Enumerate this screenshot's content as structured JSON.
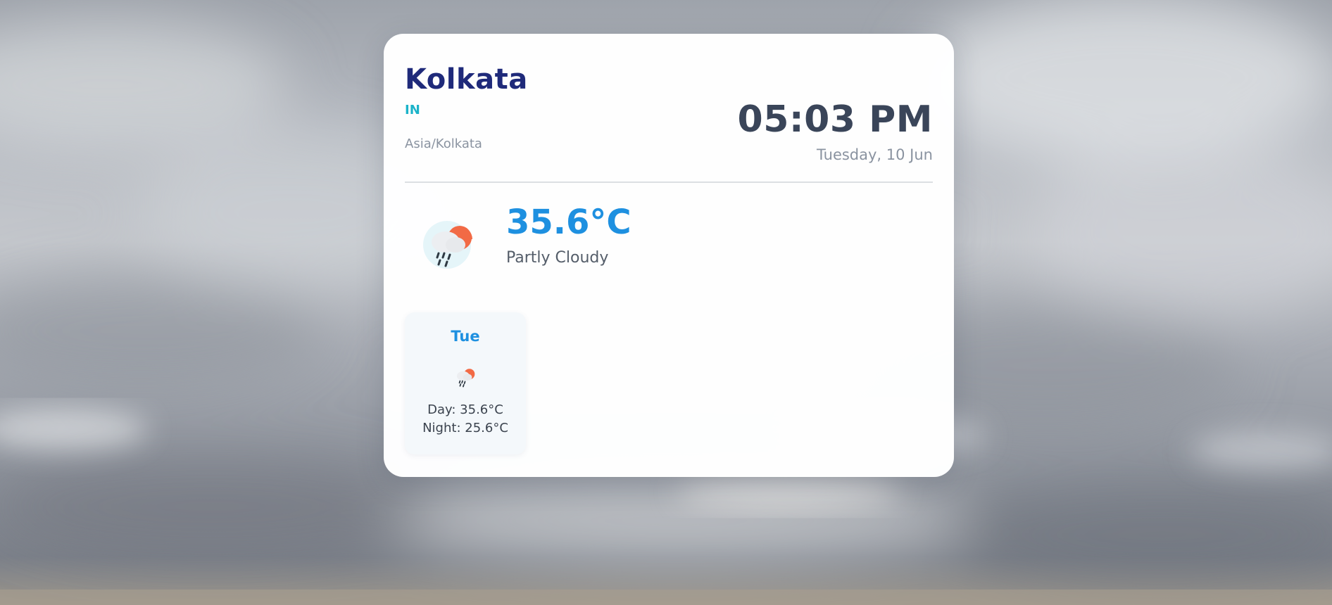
{
  "location": {
    "city": "Kolkata",
    "country": "IN",
    "timezone": "Asia/Kolkata"
  },
  "clock": {
    "time": "05:03 PM",
    "date": "Tuesday, 10 Jun"
  },
  "current": {
    "temperature": "35.6°C",
    "condition": "Partly Cloudy",
    "icon": "partly-cloudy-rain-icon"
  },
  "forecast": [
    {
      "day": "Tue",
      "icon": "partly-cloudy-rain-icon",
      "day_temp": "Day: 35.6°C",
      "night_temp": "Night: 25.6°C"
    }
  ],
  "colors": {
    "city": "#1f2a7a",
    "country": "#1bb3c9",
    "accent": "#1e90e0",
    "time": "#3a4559",
    "muted": "#8a93a0"
  }
}
